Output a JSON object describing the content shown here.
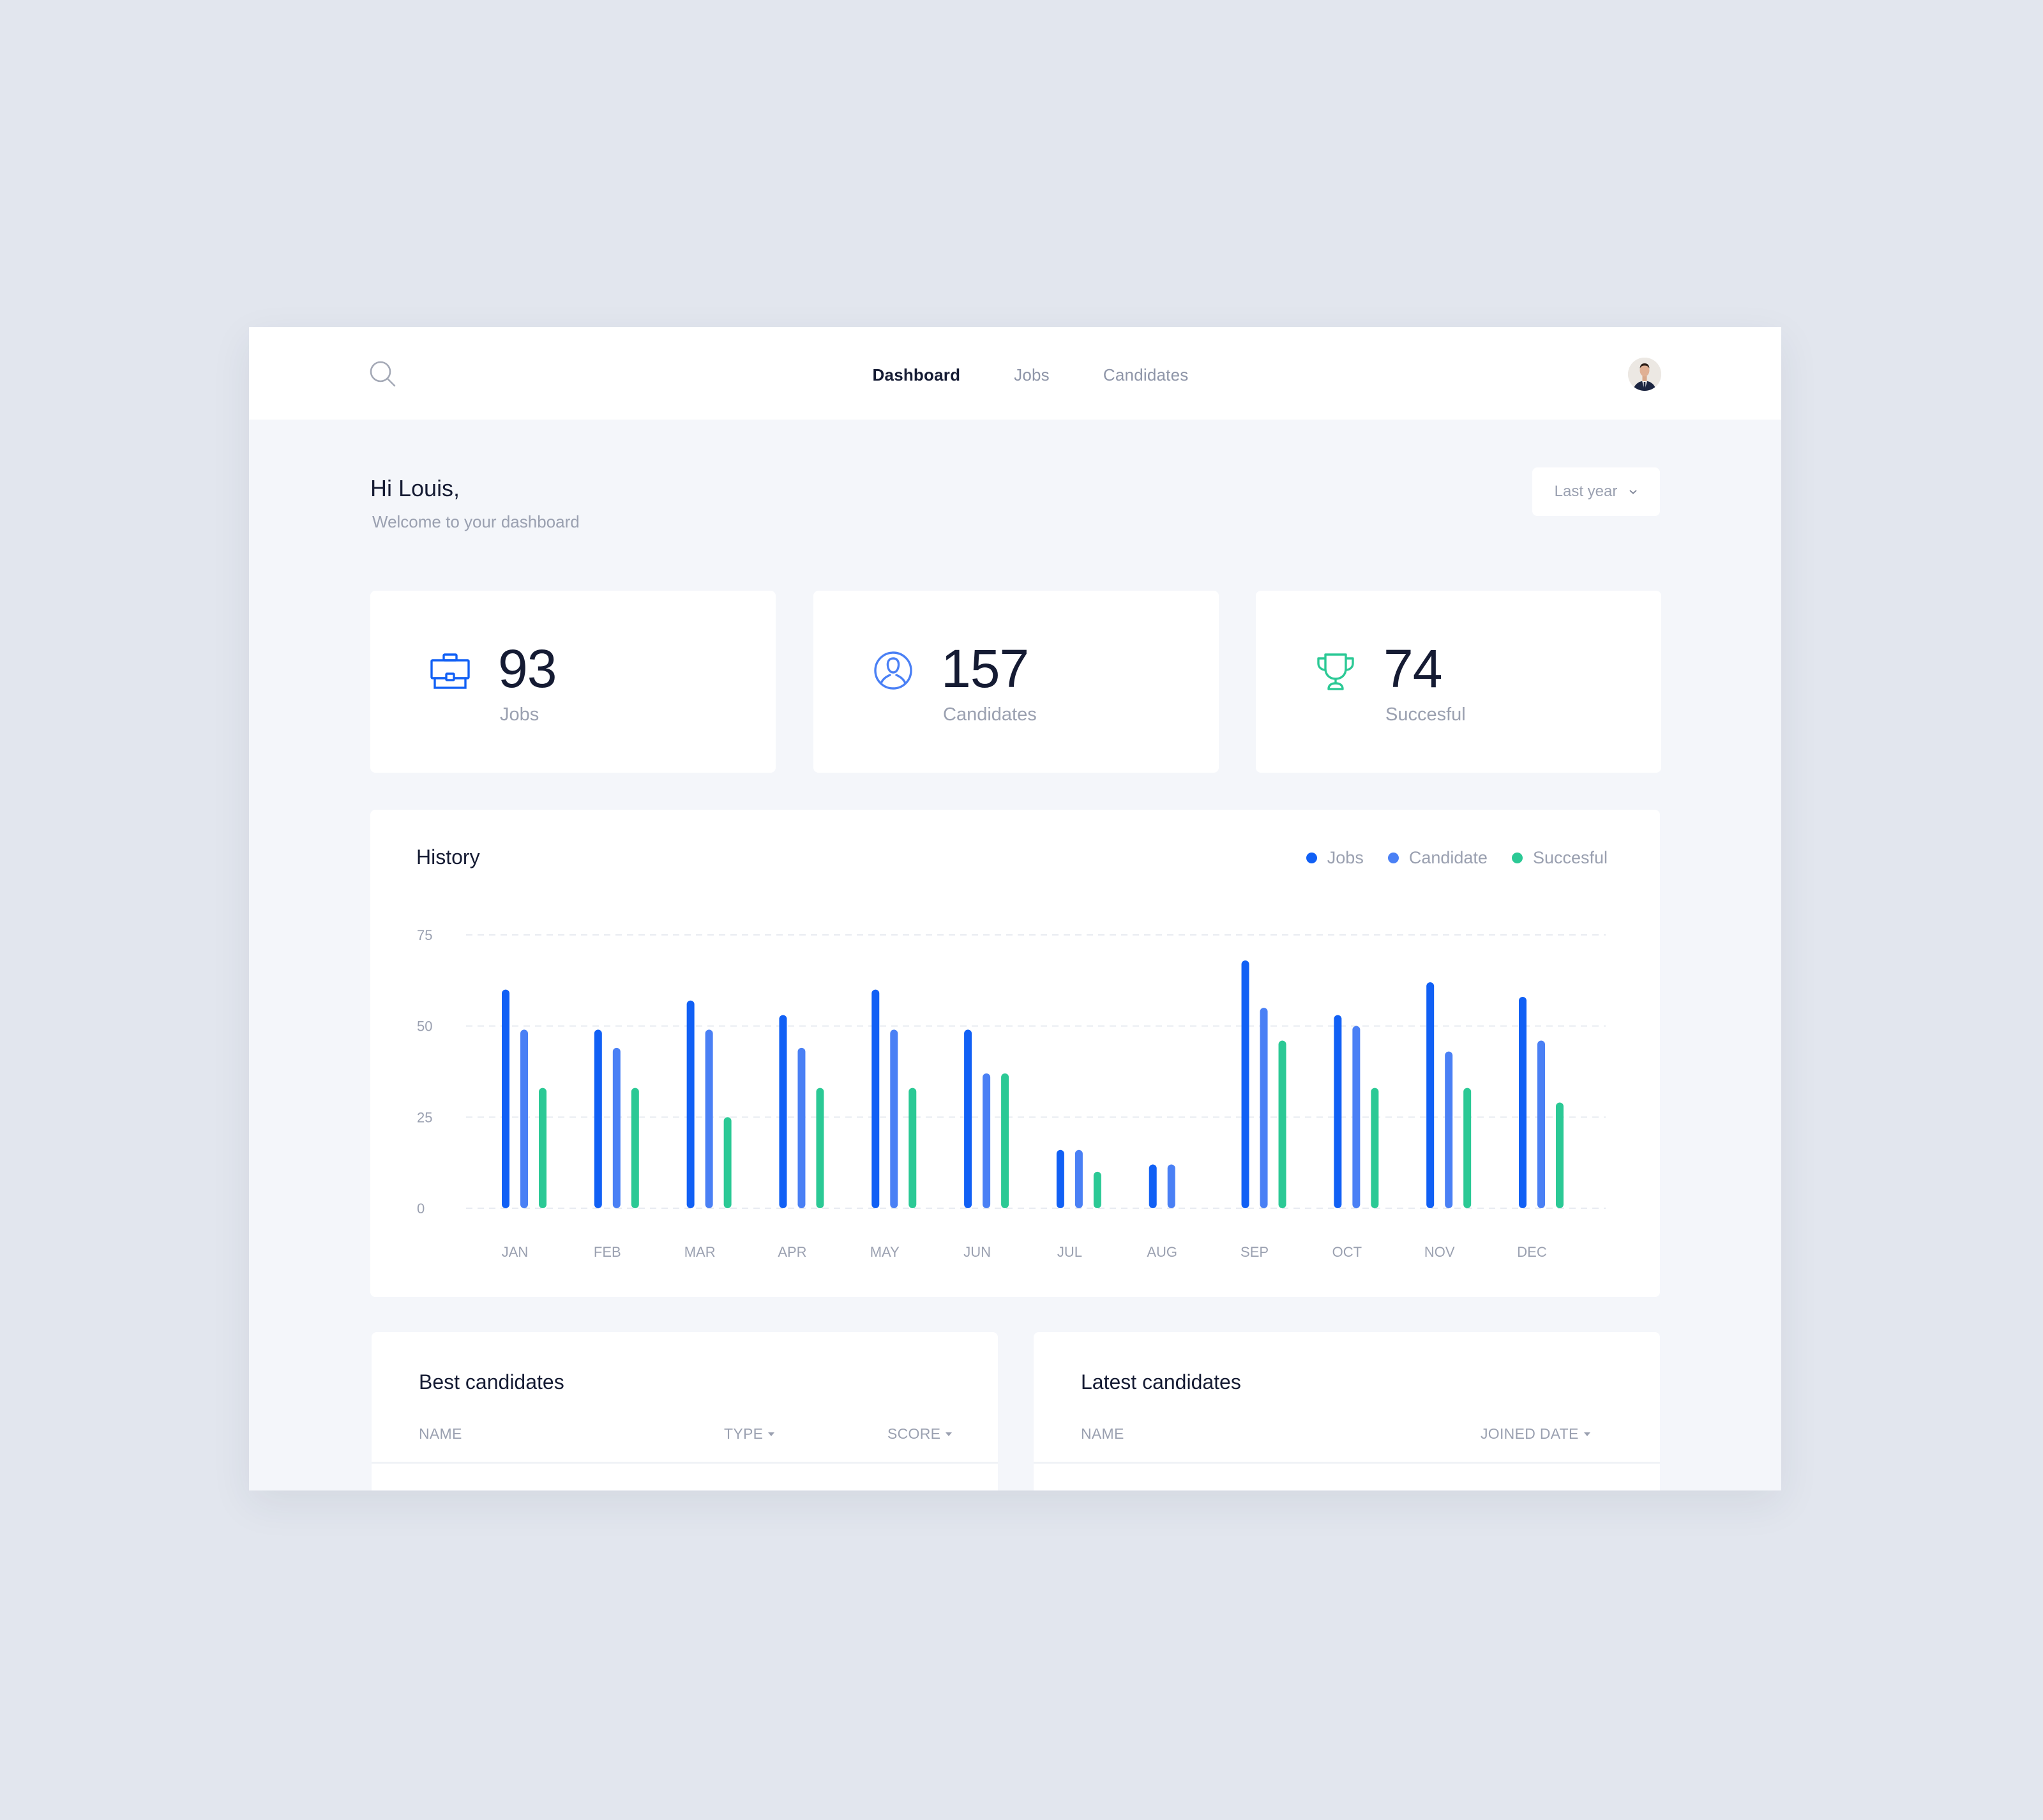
{
  "nav": {
    "search_icon": "search-icon",
    "items": [
      {
        "label": "Dashboard",
        "active": true
      },
      {
        "label": "Jobs",
        "active": false
      },
      {
        "label": "Candidates",
        "active": false
      }
    ],
    "avatar": "user-avatar"
  },
  "header": {
    "greeting": "Hi Louis,",
    "subtitle": "Welcome to your dashboard",
    "period_select": {
      "value": "Last year",
      "icon": "chevron-down-icon"
    }
  },
  "stats": [
    {
      "icon": "briefcase-icon",
      "value": "93",
      "label": "Jobs",
      "color": "#1160f5"
    },
    {
      "icon": "user-circle-icon",
      "value": "157",
      "label": "Candidates",
      "color": "#4a80f5"
    },
    {
      "icon": "trophy-icon",
      "value": "74",
      "label": "Succesful",
      "color": "#2bc995"
    }
  ],
  "history": {
    "title": "History",
    "legend": [
      {
        "label": "Jobs",
        "color": "#1160f5"
      },
      {
        "label": "Candidate",
        "color": "#4a80f5"
      },
      {
        "label": "Succesful",
        "color": "#2bc995"
      }
    ]
  },
  "chart_data": {
    "type": "bar",
    "title": "History",
    "xlabel": "",
    "ylabel": "",
    "categories": [
      "JAN",
      "FEB",
      "MAR",
      "APR",
      "MAY",
      "JUN",
      "JUL",
      "AUG",
      "SEP",
      "OCT",
      "NOV",
      "DEC"
    ],
    "yticks": [
      0,
      25,
      50,
      75
    ],
    "ylim": [
      0,
      75
    ],
    "grid": true,
    "legend_position": "top-right",
    "series": [
      {
        "name": "Jobs",
        "color": "#1160f5",
        "values": [
          60,
          49,
          57,
          53,
          60,
          49,
          16,
          12,
          68,
          53,
          62,
          58
        ]
      },
      {
        "name": "Candidate",
        "color": "#4a80f5",
        "values": [
          49,
          44,
          49,
          44,
          49,
          37,
          16,
          12,
          55,
          50,
          43,
          46
        ]
      },
      {
        "name": "Succesful",
        "color": "#2bc995",
        "values": [
          33,
          33,
          25,
          33,
          33,
          37,
          10,
          0,
          46,
          33,
          33,
          29
        ]
      }
    ]
  },
  "best_candidates": {
    "title": "Best candidates",
    "columns": [
      {
        "label": "NAME",
        "sortable": false
      },
      {
        "label": "TYPE",
        "sortable": true
      },
      {
        "label": "SCORE",
        "sortable": true
      }
    ]
  },
  "latest_candidates": {
    "title": "Latest candidates",
    "columns": [
      {
        "label": "NAME",
        "sortable": false
      },
      {
        "label": "JOINED DATE",
        "sortable": true
      }
    ]
  }
}
